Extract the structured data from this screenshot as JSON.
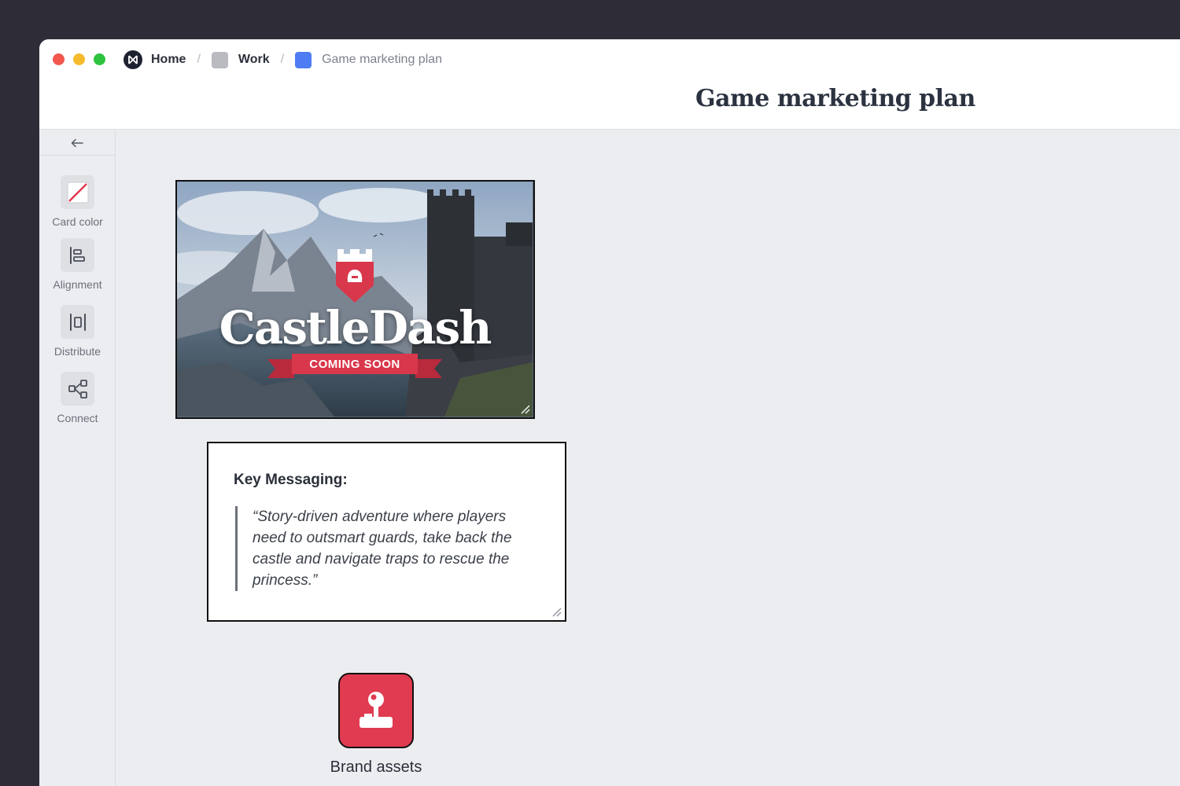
{
  "breadcrumb": {
    "home": "Home",
    "work": "Work",
    "current": "Game marketing plan",
    "separator": "/"
  },
  "page": {
    "title": "Game marketing plan"
  },
  "sidebar": {
    "back_icon": "arrow-left-icon",
    "tools": [
      {
        "label": "Card color",
        "icon": "slash-swatch-icon"
      },
      {
        "label": "Alignment",
        "icon": "align-left-icon"
      },
      {
        "label": "Distribute",
        "icon": "distribute-icon"
      },
      {
        "label": "Connect",
        "icon": "connect-icon"
      }
    ]
  },
  "image_card": {
    "logo_text": "CastleDash",
    "ribbon_text": "COMING SOON"
  },
  "text_card": {
    "title": "Key Messaging:",
    "quote": "“Story-driven adventure where players need to outsmart guards, take back the castle and navigate traps to rescue the princess.”"
  },
  "brand_card": {
    "label": "Brand assets",
    "sublabel": "",
    "icon": "joystick-icon"
  },
  "colors": {
    "accent_red": "#e03b50",
    "breadcrumb_blue": "#4e7df3",
    "canvas_bg": "#ecedf0",
    "desktop_bg": "#2e2d37"
  }
}
